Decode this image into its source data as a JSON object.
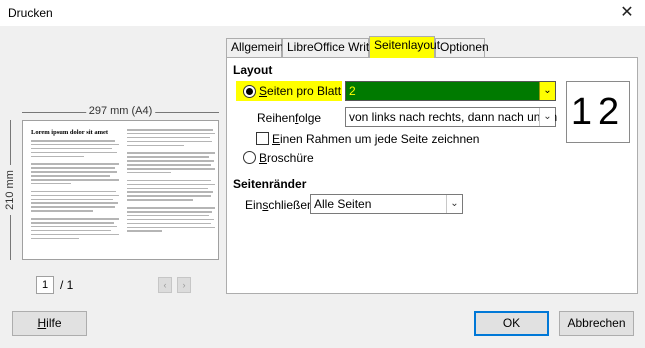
{
  "window": {
    "title": "Drucken",
    "close_symbol": "✕"
  },
  "preview": {
    "width_label": "297 mm (A4)",
    "height_label": "210 mm",
    "page_heading": "Lorem ipsum dolor sit amet",
    "current_page": "1",
    "total_pages": "/ 1",
    "prev_symbol": "‹",
    "next_symbol": "›"
  },
  "tabs": [
    {
      "label": "Allgemein",
      "active": false
    },
    {
      "label": "LibreOffice Writer",
      "active": false
    },
    {
      "label": "Seitenlayout",
      "active": true
    },
    {
      "label": "Optionen",
      "active": false
    }
  ],
  "layout": {
    "section_title": "Layout",
    "pages_per_sheet": {
      "label_underlined": "S",
      "label_rest": "eiten pro Blatt",
      "value": "2",
      "selected": true
    },
    "order": {
      "label_prefix": "Reihen",
      "label_underlined": "f",
      "label_rest": "olge",
      "value": "von links nach rechts, dann nach unten"
    },
    "border_checkbox": {
      "label_underlined": "E",
      "label_rest": "inen Rahmen um jede Seite zeichnen",
      "checked": false
    },
    "brochure": {
      "label_underlined": "B",
      "label_rest": "roschüre",
      "selected": false
    },
    "pages_preview_text": "12"
  },
  "margins": {
    "section_title": "Seitenränder",
    "include": {
      "label_prefix": "Ein",
      "label_underlined": "s",
      "label_rest": "chließen",
      "value": "Alle Seiten"
    }
  },
  "buttons": {
    "help_underlined": "H",
    "help_rest": "ilfe",
    "ok": "OK",
    "cancel": "Abbrechen"
  },
  "colors": {
    "highlight": "#ffff00",
    "selection_green": "#007a00",
    "focus_border": "#0078d7"
  },
  "icons": {
    "close": "close-icon",
    "combo_arrow": "chevron-down-icon",
    "prev": "chevron-left-icon",
    "next": "chevron-right-icon"
  }
}
